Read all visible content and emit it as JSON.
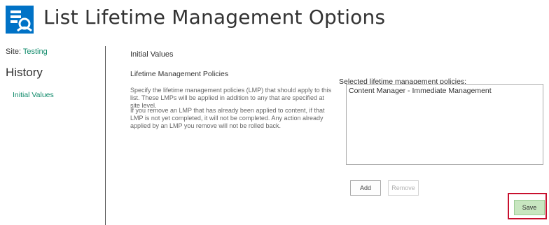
{
  "header": {
    "title": "List Lifetime Management Options",
    "logo_icon": "sharepoint-settings-icon",
    "logo_color": "#0072c6"
  },
  "sidebar": {
    "site_label": "Site: ",
    "site_name": "Testing",
    "heading": "History",
    "nav_items": [
      {
        "label": "Initial Values"
      }
    ]
  },
  "main": {
    "section_title": "Initial Values",
    "lmp_heading": "Lifetime Management Policies",
    "description_1": "Specify the lifetime management policies (LMP) that should apply to this list. These LMPs will be applied in addition to any that are specified at site level.",
    "description_2": "If you remove an LMP that has already been applied to content, if that LMP is not yet completed, it will not be completed. Any action already applied by an LMP you remove will not be rolled back.",
    "selected_label": "Selected lifetime management policies:",
    "selected_policies": [
      "Content Manager - Immediate Management"
    ]
  },
  "buttons": {
    "add": "Add",
    "remove": "Remove",
    "save": "Save"
  },
  "colors": {
    "link": "#0f8a6a",
    "save_bg": "#c8e6c0",
    "highlight": "#c8102e"
  }
}
